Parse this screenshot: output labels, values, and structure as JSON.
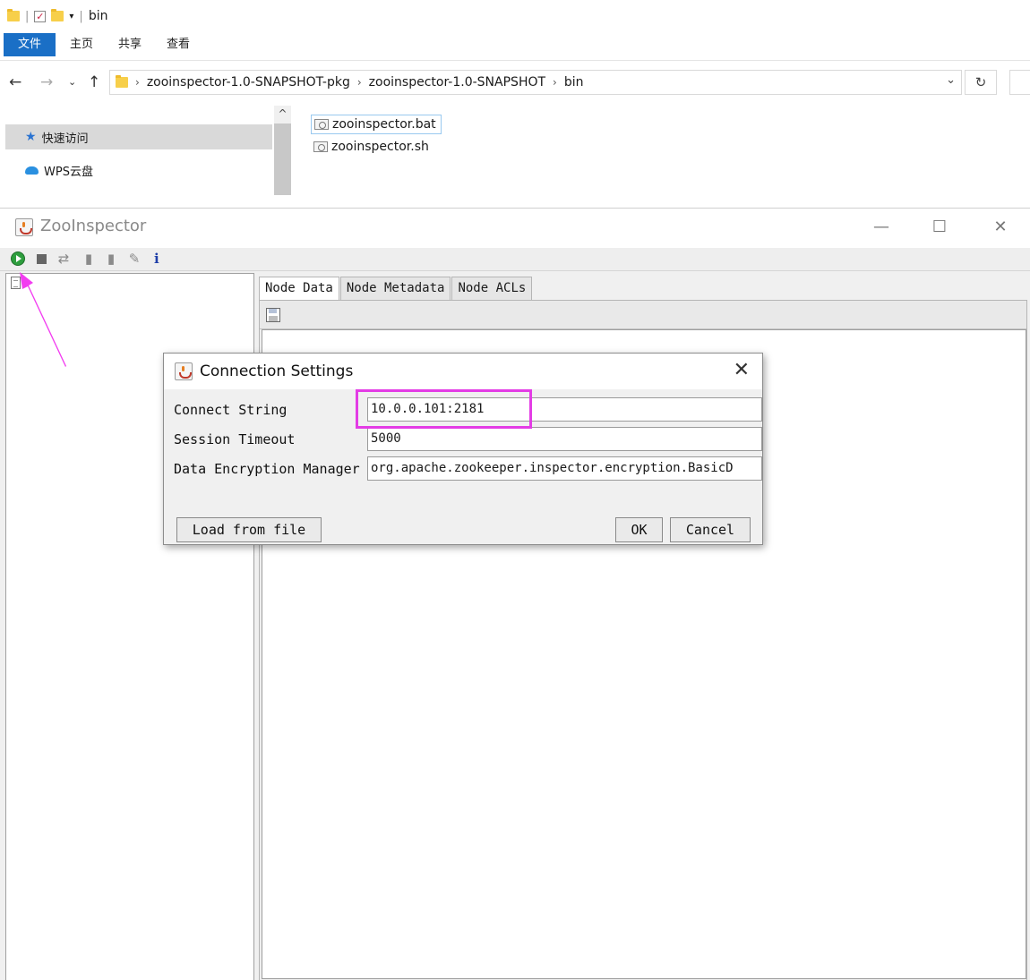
{
  "explorer": {
    "title": "bin",
    "ribbon_tabs": [
      "文件",
      "主页",
      "共享",
      "查看"
    ],
    "breadcrumb": [
      "zooinspector-1.0-SNAPSHOT-pkg",
      "zooinspector-1.0-SNAPSHOT",
      "bin"
    ],
    "nav_items": [
      {
        "label": "快速访问",
        "icon": "star-icon",
        "selected": true
      },
      {
        "label": "WPS云盘",
        "icon": "cloud-icon",
        "selected": false
      }
    ],
    "files": [
      {
        "name": "zooinspector.bat",
        "selected": true
      },
      {
        "name": "zooinspector.sh",
        "selected": false
      }
    ]
  },
  "zoo": {
    "title": "ZooInspector",
    "toolbar_icons": [
      "connect-icon",
      "disconnect-icon",
      "refresh-icon",
      "add-node-icon",
      "delete-node-icon",
      "edit-icon",
      "info-icon"
    ],
    "tabs": [
      "Node Data",
      "Node Metadata",
      "Node ACLs"
    ],
    "active_tab": "Node Data"
  },
  "dialog": {
    "title": "Connection Settings",
    "connect_label": "Connect String",
    "connect_value": "10.0.0.101:2181",
    "timeout_label": "Session Timeout",
    "timeout_value": "5000",
    "encryption_label": "Data Encryption Manager",
    "encryption_value": "org.apache.zookeeper.inspector.encryption.BasicD",
    "load_button": "Load from file",
    "ok_button": "OK",
    "cancel_button": "Cancel"
  },
  "annotation_colors": {
    "highlight": "#e33ce5",
    "arrow": "#f23cf0"
  }
}
